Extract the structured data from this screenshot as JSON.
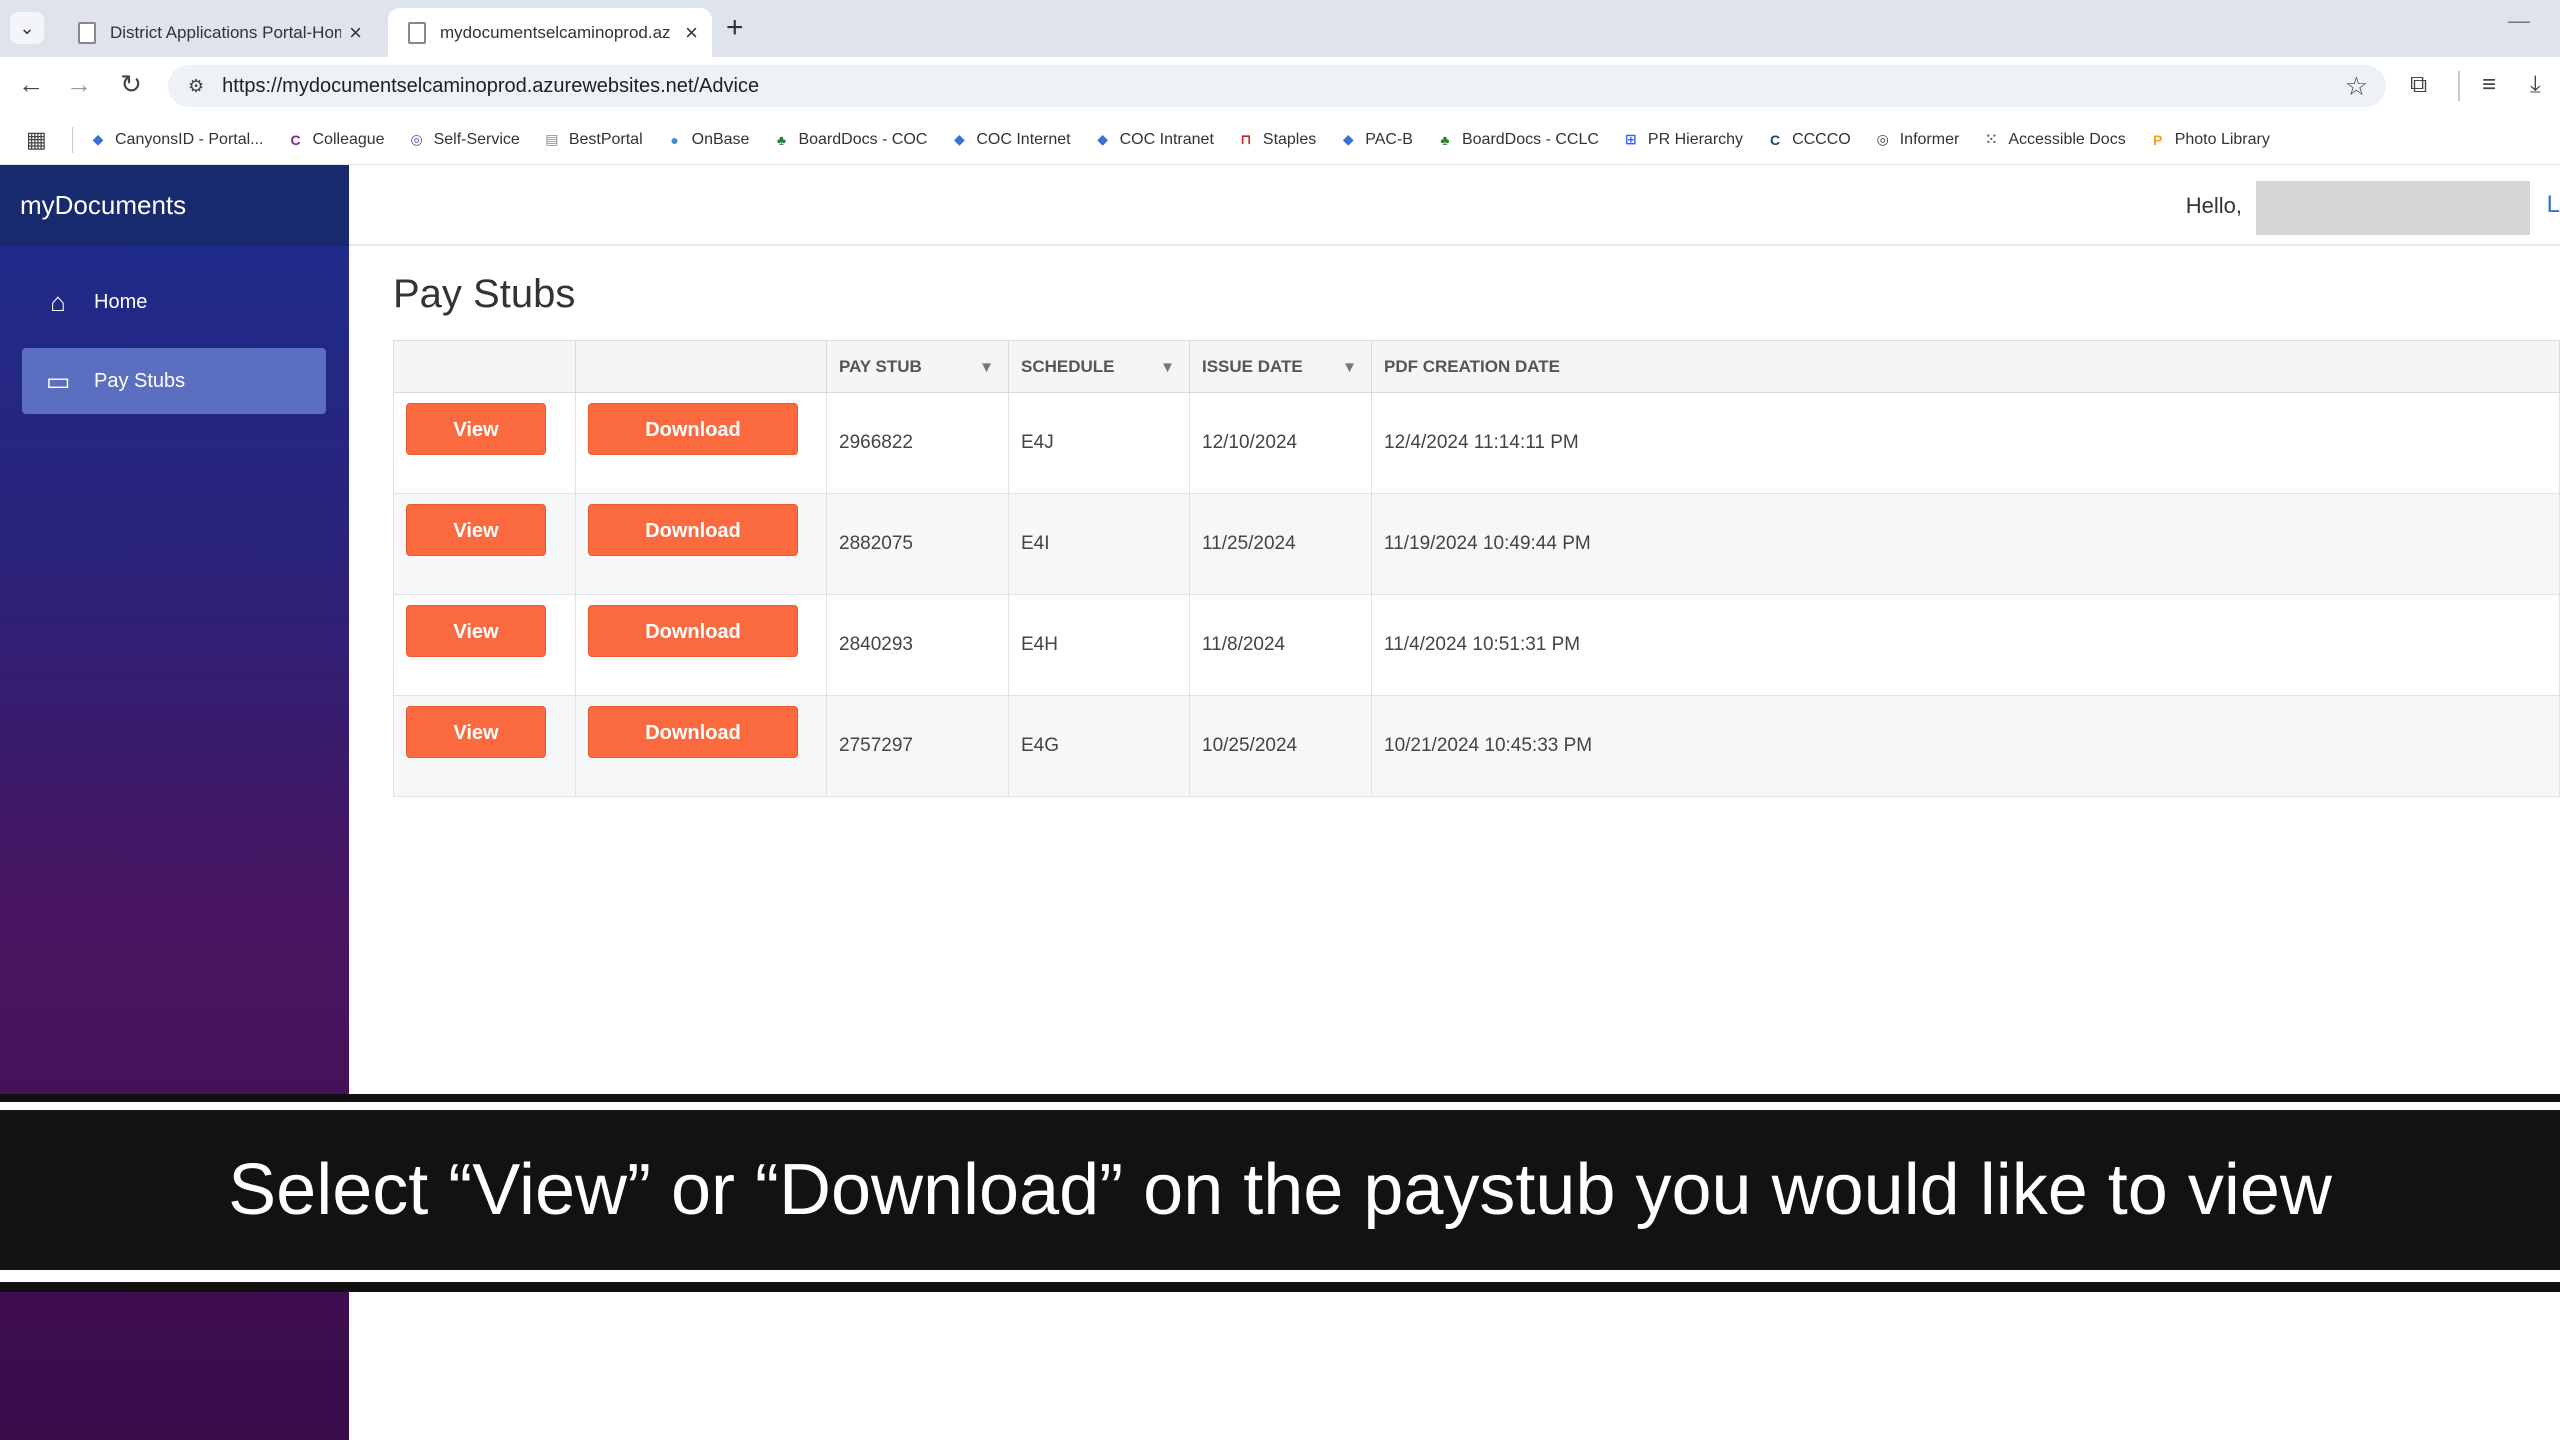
{
  "browser": {
    "tabs": [
      {
        "title": "District Applications Portal-Hom",
        "active": false
      },
      {
        "title": "mydocumentselcaminoprod.az",
        "active": true
      }
    ],
    "url": "https://mydocumentselcaminoprod.azurewebsites.net/Advice",
    "bookmarks": [
      {
        "label": "CanyonsID - Portal...",
        "icon": "diamond-icon",
        "color": "#3b6fd8"
      },
      {
        "label": "Colleague",
        "icon": "c-logo-icon",
        "color": "#7b2a8c"
      },
      {
        "label": "Self-Service",
        "icon": "circle-logo-icon",
        "color": "#4a4fbf"
      },
      {
        "label": "BestPortal",
        "icon": "page-icon",
        "color": "#888888"
      },
      {
        "label": "OnBase",
        "icon": "globe-icon",
        "color": "#3a8fd6"
      },
      {
        "label": "BoardDocs - COC",
        "icon": "tree-icon",
        "color": "#2e7d32"
      },
      {
        "label": "COC Internet",
        "icon": "diamond-icon",
        "color": "#3b6fd8"
      },
      {
        "label": "COC Intranet",
        "icon": "diamond-icon",
        "color": "#3b6fd8"
      },
      {
        "label": "Staples",
        "icon": "staple-icon",
        "color": "#cc1f1f"
      },
      {
        "label": "PAC-B",
        "icon": "diamond-icon",
        "color": "#3b6fd8"
      },
      {
        "label": "BoardDocs - CCLC",
        "icon": "tree-icon",
        "color": "#2e7d32"
      },
      {
        "label": "PR Hierarchy",
        "icon": "hierarchy-icon",
        "color": "#2962ff"
      },
      {
        "label": "CCCCO",
        "icon": "c-logo-icon",
        "color": "#1a3f7a"
      },
      {
        "label": "Informer",
        "icon": "circle-logo-icon",
        "color": "#444444"
      },
      {
        "label": "Accessible Docs",
        "icon": "grid-logo-icon",
        "color": "#666666"
      },
      {
        "label": "Photo Library",
        "icon": "p-logo-icon",
        "color": "#f2a31b"
      }
    ]
  },
  "app": {
    "brand": "myDocuments",
    "nav": [
      {
        "label": "Home",
        "icon": "home-icon"
      },
      {
        "label": "Pay Stubs",
        "icon": "card-icon",
        "active": true
      }
    ],
    "header": {
      "hello": "Hello,",
      "logout": "L"
    },
    "page_title": "Pay Stubs",
    "table": {
      "columns": [
        "",
        "",
        "PAY STUB",
        "SCHEDULE",
        "ISSUE DATE",
        "PDF CREATION DATE"
      ],
      "view_label": "View",
      "download_label": "Download",
      "rows": [
        {
          "pay_stub": "2966822",
          "schedule": "E4J",
          "issue_date": "12/10/2024",
          "pdf_creation_date": "12/4/2024 11:14:11 PM"
        },
        {
          "pay_stub": "2882075",
          "schedule": "E4I",
          "issue_date": "11/25/2024",
          "pdf_creation_date": "11/19/2024 10:49:44 PM"
        },
        {
          "pay_stub": "2840293",
          "schedule": "E4H",
          "issue_date": "11/8/2024",
          "pdf_creation_date": "11/4/2024 10:51:31 PM"
        },
        {
          "pay_stub": "2757297",
          "schedule": "E4G",
          "issue_date": "10/25/2024",
          "pdf_creation_date": "10/21/2024 10:45:33 PM"
        }
      ]
    }
  },
  "caption": "Select “View” or “Download” on the paystub you would like to view",
  "colors": {
    "accent": "#fb6a3f",
    "sidebar_top": "#1e2d8f",
    "sidebar_bottom": "#3a0c4a",
    "active_nav": "#5a6fbf"
  }
}
